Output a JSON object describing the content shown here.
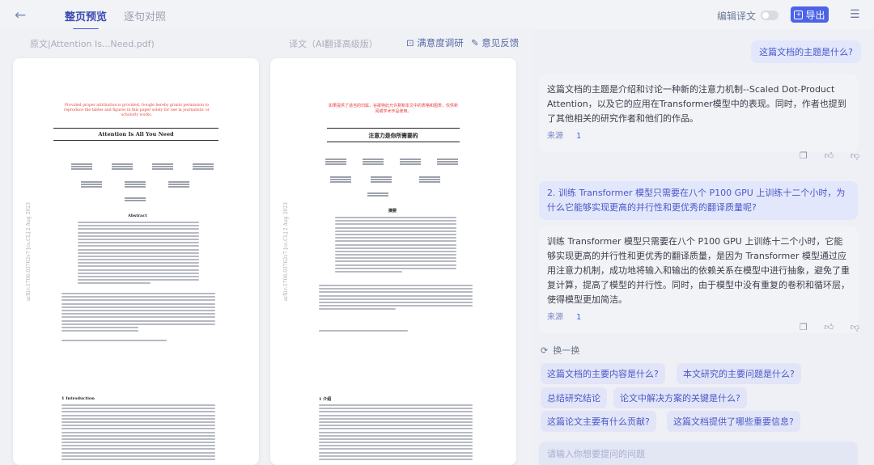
{
  "topbar": {
    "tabs": [
      {
        "label": "整页预览",
        "active": true
      },
      {
        "label": "逐句对照",
        "active": false
      }
    ],
    "edit_translation": "编辑译文",
    "export_label": "导出"
  },
  "left": {
    "original_label": "原文|Attention Is...Need.pdf)",
    "translated_label": "译文（AI翻译高级版）",
    "survey_link": "满意度调研",
    "feedback_link": "意见反馈",
    "original_page": {
      "notice": "Provided proper attribution is provided, Google hereby grants permission to reproduce the tables and figures in this paper solely for use in journalistic or scholarly works.",
      "title": "Attention Is All You Need",
      "arxiv": "arXiv:1706.03762v7 [cs.CL] 2 Aug 2023",
      "abstract": "Abstract",
      "intro": "1 Introduction"
    },
    "translated_page": {
      "notice": "如果提供了适当的归属，谷歌特此允许复制本文中的表格和图表，仅供新闻或学术作品使用。",
      "title": "注意力是你所需要的",
      "abstract": "摘要",
      "intro": "1 介绍"
    }
  },
  "chat": {
    "q1": "这篇文档的主题是什么?",
    "a1": "这篇文档的主题是介绍和讨论一种新的注意力机制--Scaled Dot-Product Attention，以及它的应用在Transformer模型中的表现。同时，作者也提到了其他相关的研究作者和他们的作品。",
    "a1_cite": "来源",
    "a1_ref": "1",
    "q2": "2. 训练 Transformer 模型只需要在八个 P100 GPU 上训练十二个小时，为什么它能够实现更高的并行性和更优秀的翻译质量呢?",
    "a2": "训练 Transformer 模型只需要在八个 P100 GPU 上训练十二个小时，它能够实现更高的并行性和更优秀的翻译质量，是因为 Transformer 模型通过应用注意力机制，成功地将输入和输出的依赖关系在模型中进行抽象，避免了重复计算，提高了模型的并行性。同时，由于模型中没有重复的卷积和循环层，使得模型更加简洁。",
    "a2_cite": "来源",
    "a2_ref": "1",
    "refresh_label": "换一换",
    "suggestions": [
      "这篇文档的主要内容是什么?",
      "本文研究的主要问题是什么?",
      "总结研究结论",
      "论文中解决方案的关键是什么?",
      "这篇论文主要有什么贡献?",
      "这篇文档提供了哪些重要信息?"
    ],
    "input_placeholder": "请输入你想要提问的问题"
  }
}
